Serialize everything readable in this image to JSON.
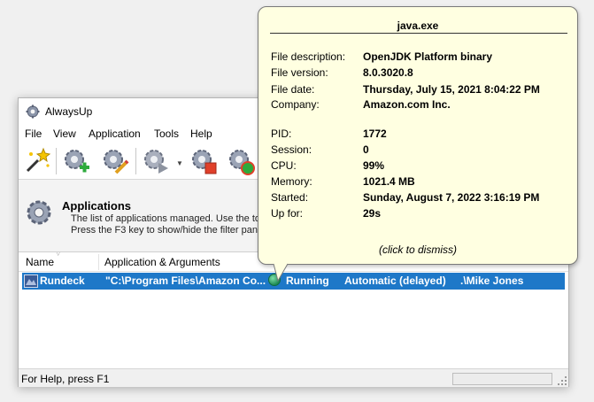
{
  "window": {
    "title": "AlwaysUp"
  },
  "menu": [
    "File",
    "View",
    "Application",
    "Tools",
    "Help"
  ],
  "toolbar": {
    "icons": [
      "wizard-icon",
      "add-application-icon",
      "edit-application-icon",
      "start-application-icon",
      "stop-application-icon",
      "restart-application-icon"
    ]
  },
  "banner": {
    "title": "Applications",
    "desc_line1": "The list of applications managed. Use the too",
    "desc_line2": "Press the F3 key to show/hide the filter pane"
  },
  "grid": {
    "columns": [
      "Name",
      "Application & Arguments"
    ],
    "rows": [
      {
        "name": "Rundeck",
        "app_args": "\"C:\\Program Files\\Amazon Co...",
        "status": "Running",
        "startup": "Automatic (delayed)",
        "account": ".\\Mike Jones"
      }
    ]
  },
  "statusbar": {
    "text": "For Help, press F1"
  },
  "tooltip": {
    "title": "java.exe",
    "group1": [
      {
        "label": "File description:",
        "value": "OpenJDK Platform binary"
      },
      {
        "label": "File version:",
        "value": "8.0.3020.8"
      },
      {
        "label": "File date:",
        "value": "Thursday, July 15, 2021 8:04:22 PM"
      },
      {
        "label": "Company:",
        "value": "Amazon.com Inc."
      }
    ],
    "group2": [
      {
        "label": "PID:",
        "value": "1772"
      },
      {
        "label": "Session:",
        "value": "0"
      },
      {
        "label": "CPU:",
        "value": "99%"
      },
      {
        "label": "Memory:",
        "value": "1021.4 MB"
      },
      {
        "label": "Started:",
        "value": "Sunday, August 7, 2022 3:16:19 PM"
      },
      {
        "label": "Up for:",
        "value": "29s"
      }
    ],
    "dismiss": "(click to dismiss)"
  },
  "colors": {
    "selection": "#1e78c8",
    "tooltip_bg": "#ffffe1",
    "status_running": "#2ea76a"
  }
}
